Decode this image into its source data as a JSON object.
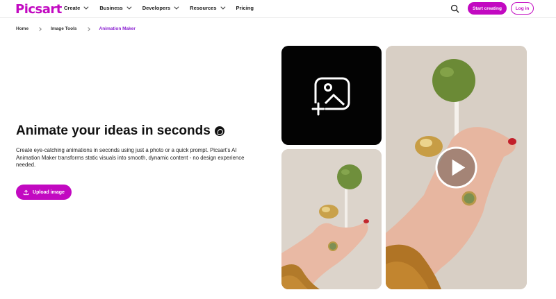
{
  "header": {
    "logo": "Picsart",
    "nav": [
      {
        "label": "Create",
        "has_dropdown": true
      },
      {
        "label": "Business",
        "has_dropdown": true
      },
      {
        "label": "Developers",
        "has_dropdown": true
      },
      {
        "label": "Resources",
        "has_dropdown": true
      },
      {
        "label": "Pricing",
        "has_dropdown": false
      }
    ],
    "start_label": "Start creating",
    "login_label": "Log in"
  },
  "breadcrumb": {
    "home": "Home",
    "tools": "Image Tools",
    "current": "Animation Maker"
  },
  "hero": {
    "title": "Animate your ideas in seconds",
    "description": "Create eye-catching animations in seconds using just a photo or a quick prompt. Picsart’s AI Animation Maker transforms static visuals into smooth, dynamic content - no design experience needed.",
    "upload_label": "Upload image"
  },
  "colors": {
    "brand": "#c209c1",
    "breadcrumb_active": "#8a1fd1"
  },
  "icons": [
    "search-icon",
    "add-image-icon",
    "upload-icon",
    "play-icon",
    "ai-sparkle-icon",
    "chevron-down-icon"
  ]
}
